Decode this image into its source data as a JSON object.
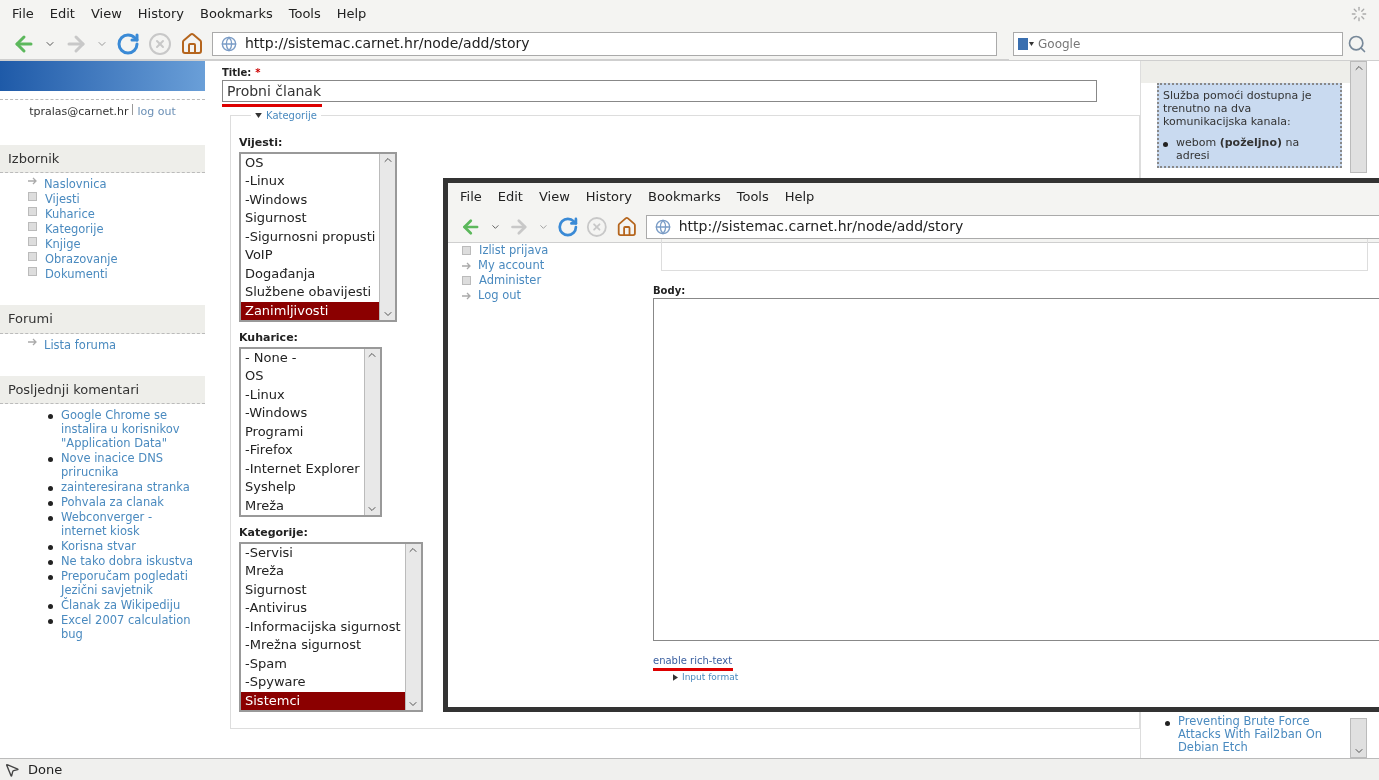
{
  "menu_bar": {
    "items": [
      "File",
      "Edit",
      "View",
      "History",
      "Bookmarks",
      "Tools",
      "Help"
    ]
  },
  "toolbar": {
    "url": "http://sistemac.carnet.hr/node/add/story",
    "search_placeholder": "Google"
  },
  "sidebar": {
    "user": "tpralas@carnet.hr",
    "logout": "log out",
    "blocks": [
      {
        "title": "Izbornik",
        "items": [
          {
            "label": "Naslovnica",
            "kind": "arrow"
          },
          {
            "label": "Vijesti",
            "kind": "square"
          },
          {
            "label": "Kuharice",
            "kind": "square"
          },
          {
            "label": "Kategorije",
            "kind": "square"
          },
          {
            "label": "Knjige",
            "kind": "square"
          },
          {
            "label": "Obrazovanje",
            "kind": "square"
          },
          {
            "label": "Dokumenti",
            "kind": "square"
          }
        ]
      },
      {
        "title": "Forumi",
        "items": [
          {
            "label": "Lista foruma",
            "kind": "arrow"
          }
        ]
      },
      {
        "title": "Posljednji komentari",
        "items": [
          {
            "label": "Google Chrome se instalira u korisnikov \"Application Data\"",
            "kind": "bullet"
          },
          {
            "label": "Nove inacice DNS prirucnika",
            "kind": "bullet"
          },
          {
            "label": "zainteresirana stranka",
            "kind": "bullet"
          },
          {
            "label": "Pohvala za clanak",
            "kind": "bullet"
          },
          {
            "label": "Webconverger - internet kiosk",
            "kind": "bullet"
          },
          {
            "label": "Korisna stvar",
            "kind": "bullet"
          },
          {
            "label": "Ne tako dobra iskustva",
            "kind": "bullet"
          },
          {
            "label": "Preporučam pogledati Jezični savjetnik",
            "kind": "bullet"
          },
          {
            "label": "Članak za Wikipediju",
            "kind": "bullet"
          },
          {
            "label": "Excel 2007 calculation bug",
            "kind": "bullet"
          }
        ]
      }
    ]
  },
  "form": {
    "title_label": "Title:",
    "required_mark": "*",
    "title_value": "Probni članak",
    "fieldset_legend": "Kategorije",
    "lists": [
      {
        "label": "Vijesti:",
        "options": [
          {
            "label": "OS",
            "selected": false
          },
          {
            "label": "-Linux",
            "selected": false
          },
          {
            "label": "-Windows",
            "selected": false
          },
          {
            "label": "Sigurnost",
            "selected": false
          },
          {
            "label": "-Sigurnosni propusti",
            "selected": false
          },
          {
            "label": "VoIP",
            "selected": false
          },
          {
            "label": "Događanja",
            "selected": false
          },
          {
            "label": "Službene obavijesti",
            "selected": false
          },
          {
            "label": "Zanimljivosti",
            "selected": true
          }
        ]
      },
      {
        "label": "Kuharice:",
        "options": [
          {
            "label": "- None -",
            "selected": false
          },
          {
            "label": "OS",
            "selected": false
          },
          {
            "label": "-Linux",
            "selected": false
          },
          {
            "label": "-Windows",
            "selected": false
          },
          {
            "label": "Programi",
            "selected": false
          },
          {
            "label": "-Firefox",
            "selected": false
          },
          {
            "label": "-Internet Explorer",
            "selected": false
          },
          {
            "label": "Syshelp",
            "selected": false
          },
          {
            "label": "Mreža",
            "selected": false
          }
        ]
      },
      {
        "label": "Kategorije:",
        "options": [
          {
            "label": "-Servisi",
            "selected": false
          },
          {
            "label": "Mreža",
            "selected": false
          },
          {
            "label": "Sigurnost",
            "selected": false
          },
          {
            "label": "-Antivirus",
            "selected": false
          },
          {
            "label": "-Informacijska sigurnost",
            "selected": false
          },
          {
            "label": "-Mrežna sigurnost",
            "selected": false
          },
          {
            "label": "-Spam",
            "selected": false
          },
          {
            "label": "-Spyware",
            "selected": false
          },
          {
            "label": "Sistemci",
            "selected": true
          }
        ]
      }
    ]
  },
  "right_sidebar": {
    "text": "Služba pomoći dostupna je trenutno na dva komunikacijska kanala:",
    "bullet": "webom **(poželjno)** na adresi",
    "links": [
      "Preventing Brute Force Attacks With Fail2ban On Debian Etch"
    ]
  },
  "inset": {
    "menu_items": [
      "File",
      "Edit",
      "View",
      "History",
      "Bookmarks",
      "Tools",
      "Help"
    ],
    "url": "http://sistemac.carnet.hr/node/add/story",
    "nav": [
      {
        "label": "Izlist prijava",
        "kind": "square"
      },
      {
        "label": "My account",
        "kind": "arrow"
      },
      {
        "label": "Administer",
        "kind": "square"
      },
      {
        "label": "Log out",
        "kind": "arrow"
      }
    ],
    "body_label": "Body:",
    "rich_text_link": "enable rich-text",
    "input_format": "Input format"
  },
  "status_bar": {
    "text": "Done"
  }
}
